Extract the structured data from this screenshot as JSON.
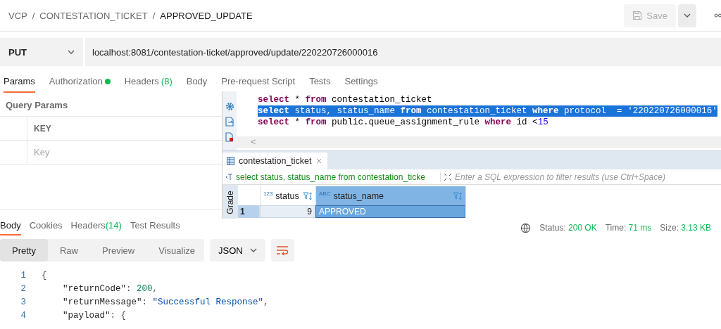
{
  "breadcrumb": {
    "separator": "/",
    "items": [
      "VCP",
      "CONTESTATION_TICKET",
      "APPROVED_UPDATE"
    ]
  },
  "save_button": {
    "label": "Save",
    "disabled": true
  },
  "request": {
    "method": "PUT",
    "url": "localhost:8081/contestation-ticket/approved/update/220220726000016"
  },
  "request_tabs": [
    {
      "label": "Params",
      "indicator": false,
      "selected": true
    },
    {
      "label": "Authorization",
      "indicator": true,
      "selected": false
    },
    {
      "label": "Headers",
      "count": "(8)",
      "indicator": false,
      "selected": false
    },
    {
      "label": "Body",
      "indicator": false,
      "selected": false
    },
    {
      "label": "Pre-request Script",
      "indicator": false,
      "selected": false
    },
    {
      "label": "Tests",
      "indicator": false,
      "selected": false
    },
    {
      "label": "Settings",
      "indicator": false,
      "selected": false
    }
  ],
  "query_params": {
    "title": "Query Params",
    "column": "KEY",
    "placeholder": "Key"
  },
  "sql_tool": {
    "editor_lines": [
      {
        "selected": false,
        "tokens": [
          {
            "kind": "keyword",
            "text": "select"
          },
          {
            "kind": "plain",
            "text": " * "
          },
          {
            "kind": "keyword",
            "text": "from"
          },
          {
            "kind": "plain",
            "text": " contestation_ticket"
          }
        ]
      },
      {
        "selected": true,
        "tokens": [
          {
            "kind": "keyword",
            "text": "select"
          },
          {
            "kind": "plain",
            "text": " status, status_name "
          },
          {
            "kind": "keyword",
            "text": "from"
          },
          {
            "kind": "plain",
            "text": " contestation_ticket "
          },
          {
            "kind": "keyword",
            "text": "where"
          },
          {
            "kind": "plain",
            "text": " protocol  = "
          },
          {
            "kind": "string",
            "text": "'220220726000016'"
          }
        ]
      },
      {
        "selected": false,
        "tokens": [
          {
            "kind": "keyword",
            "text": "select"
          },
          {
            "kind": "plain",
            "text": " * "
          },
          {
            "kind": "keyword",
            "text": "from"
          },
          {
            "kind": "plain",
            "text": " public.queue_assignment_rule "
          },
          {
            "kind": "keyword",
            "text": "where"
          },
          {
            "kind": "plain",
            "text": " id <"
          },
          {
            "kind": "number",
            "text": "15"
          }
        ]
      }
    ],
    "scroll_arrow": "<",
    "result_tab": "contestation_ticket",
    "filter_query": "select status, status_name from contestation_ticke",
    "filter_placeholder": "Enter a SQL expression to filter results (use Ctrl+Space)",
    "side_tab": "Grade",
    "columns": [
      {
        "type_label": "123",
        "name": "status",
        "selected": false
      },
      {
        "type_label": "ABC",
        "name": "status_name",
        "selected": true
      }
    ],
    "rows": [
      {
        "number": "1",
        "cells": [
          "9",
          "APPROVED"
        ]
      }
    ]
  },
  "response_tabs": [
    {
      "label": "Body",
      "selected": true
    },
    {
      "label": "Cookies",
      "selected": false
    },
    {
      "label": "Headers",
      "count": "(14)",
      "selected": false
    },
    {
      "label": "Test Results",
      "selected": false
    }
  ],
  "response_stats": [
    {
      "label": "Status:",
      "value": "200 OK"
    },
    {
      "label": "Time:",
      "value": "71 ms"
    },
    {
      "label": "Size:",
      "value": "3.13 KB"
    }
  ],
  "view_modes": [
    {
      "label": "Pretty",
      "selected": true
    },
    {
      "label": "Raw",
      "selected": false
    },
    {
      "label": "Preview",
      "selected": false
    },
    {
      "label": "Visualize",
      "selected": false
    }
  ],
  "format": "JSON",
  "code_lines": [
    {
      "number": "1",
      "tokens": [
        {
          "kind": "punct",
          "text": "{"
        }
      ],
      "children": [
        {
          "number": "2",
          "tokens": [
            {
              "kind": "key",
              "text": "\"returnCode\""
            },
            {
              "kind": "punct",
              "text": ": "
            },
            {
              "kind": "number",
              "text": "200"
            },
            {
              "kind": "punct",
              "text": ","
            }
          ]
        },
        {
          "number": "3",
          "tokens": [
            {
              "kind": "key",
              "text": "\"returnMessage\""
            },
            {
              "kind": "punct",
              "text": ": "
            },
            {
              "kind": "string",
              "text": "\"Successful Response\""
            },
            {
              "kind": "punct",
              "text": ","
            }
          ]
        },
        {
          "number": "4",
          "tokens": [
            {
              "kind": "key",
              "text": "\"payload\""
            },
            {
              "kind": "punct",
              "text": ": {"
            }
          ]
        }
      ]
    }
  ]
}
